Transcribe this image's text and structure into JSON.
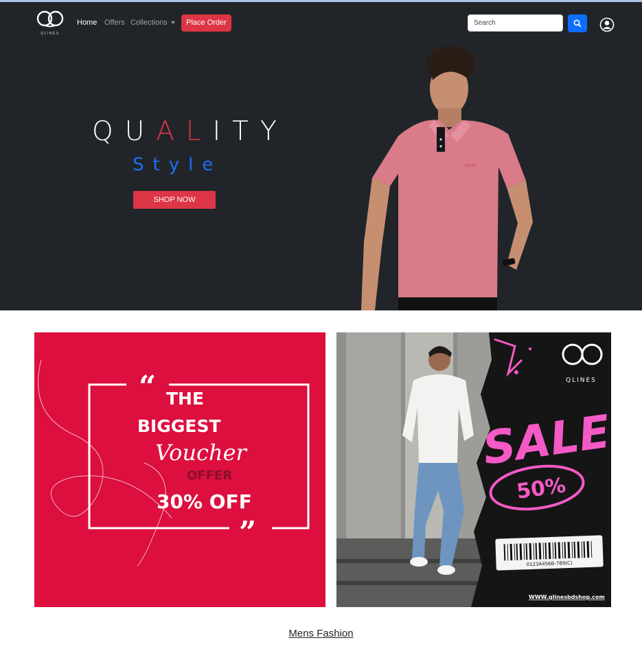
{
  "brand": {
    "name": "QLINES"
  },
  "nav": {
    "home": "Home",
    "offers": "Offers",
    "collections": "Collections",
    "place_order": "Place Order"
  },
  "search": {
    "placeholder": "Search"
  },
  "icons": {
    "logo": "qlines-logo-icon",
    "search": "search-icon",
    "user": "user-circle-icon",
    "dropdown": "chevron-down-icon"
  },
  "hero": {
    "quality_parts": [
      "QU",
      "AL",
      "ITY"
    ],
    "style_word": "Style",
    "shop_now": "SHOP NOW",
    "shirt_logo": "GBOS"
  },
  "banner_voucher": {
    "the": "THE",
    "biggest": "BIGGEST",
    "voucher": "Voucher",
    "offer": "OFFER",
    "discount": "30% OFF"
  },
  "banner_sale": {
    "brand": "QLINES",
    "sale": "SALE",
    "percent": "50%",
    "barcode_number": "0123A456B-789(C)",
    "website": "WWW.qlinesbdshop.com"
  },
  "section": {
    "title": "Mens Fashion"
  },
  "colors": {
    "hero_bg": "#212529",
    "accent_red": "#dc3545",
    "accent_blue": "#0d6efd",
    "voucher_bg": "#dc0f3e",
    "sale_pink": "#f45ac6"
  }
}
